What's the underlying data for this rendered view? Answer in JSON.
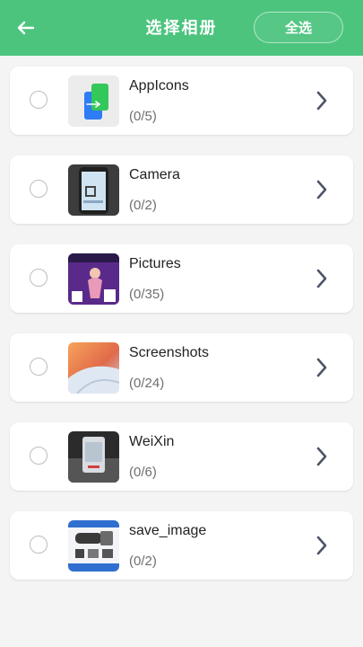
{
  "header": {
    "title": "选择相册",
    "select_all_label": "全选",
    "background": "#4cc47e"
  },
  "albums": [
    {
      "name": "AppIcons",
      "count": "(0/5)",
      "thumb": "appicons-thumb"
    },
    {
      "name": "Camera",
      "count": "(0/2)",
      "thumb": "camera-thumb"
    },
    {
      "name": "Pictures",
      "count": "(0/35)",
      "thumb": "pictures-thumb"
    },
    {
      "name": "Screenshots",
      "count": "(0/24)",
      "thumb": "screenshots-thumb"
    },
    {
      "name": "WeiXin",
      "count": "(0/6)",
      "thumb": "weixin-thumb"
    },
    {
      "name": "save_image",
      "count": "(0/2)",
      "thumb": "save-image-thumb"
    }
  ]
}
